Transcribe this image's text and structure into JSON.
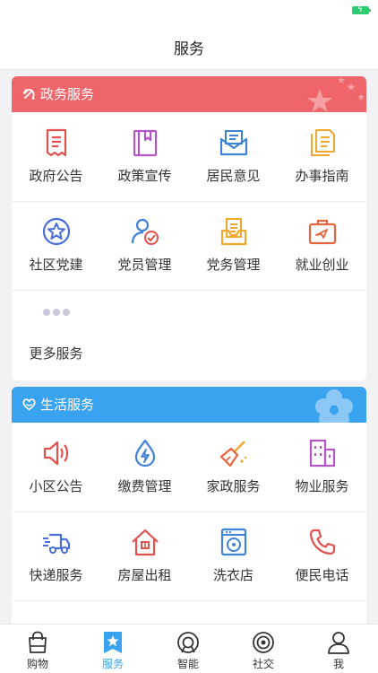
{
  "nav": {
    "title": "服务"
  },
  "colors": {
    "gov_header": "#f0656a",
    "life_header": "#3aa3f0",
    "active_tab": "#3aa3f0"
  },
  "gov_section": {
    "title": "政务服务",
    "items": [
      {
        "label": "政府公告",
        "icon": "notice-document-icon"
      },
      {
        "label": "政策宣传",
        "icon": "bookmark-book-icon"
      },
      {
        "label": "居民意见",
        "icon": "mail-envelope-icon"
      },
      {
        "label": "办事指南",
        "icon": "guide-document-icon"
      },
      {
        "label": "社区党建",
        "icon": "star-circle-icon"
      },
      {
        "label": "党员管理",
        "icon": "member-person-icon"
      },
      {
        "label": "党务管理",
        "icon": "affairs-clipboard-icon"
      },
      {
        "label": "就业创业",
        "icon": "briefcase-icon"
      },
      {
        "label": "更多服务",
        "icon": "more-dots-icon"
      }
    ]
  },
  "life_section": {
    "title": "生活服务",
    "items": [
      {
        "label": "小区公告",
        "icon": "speaker-icon"
      },
      {
        "label": "缴费管理",
        "icon": "water-drop-bolt-icon"
      },
      {
        "label": "家政服务",
        "icon": "broom-icon"
      },
      {
        "label": "物业服务",
        "icon": "building-icon"
      },
      {
        "label": "快递服务",
        "icon": "delivery-truck-icon"
      },
      {
        "label": "房屋出租",
        "icon": "house-icon"
      },
      {
        "label": "洗衣店",
        "icon": "washing-machine-icon"
      },
      {
        "label": "便民电话",
        "icon": "phone-icon"
      }
    ]
  },
  "tabs": [
    {
      "label": "购物",
      "icon": "shopping-bag-icon",
      "active": false
    },
    {
      "label": "服务",
      "icon": "service-star-icon",
      "active": true
    },
    {
      "label": "智能",
      "icon": "smart-icon",
      "active": false
    },
    {
      "label": "社交",
      "icon": "social-icon",
      "active": false
    },
    {
      "label": "我",
      "icon": "profile-icon",
      "active": false
    }
  ]
}
